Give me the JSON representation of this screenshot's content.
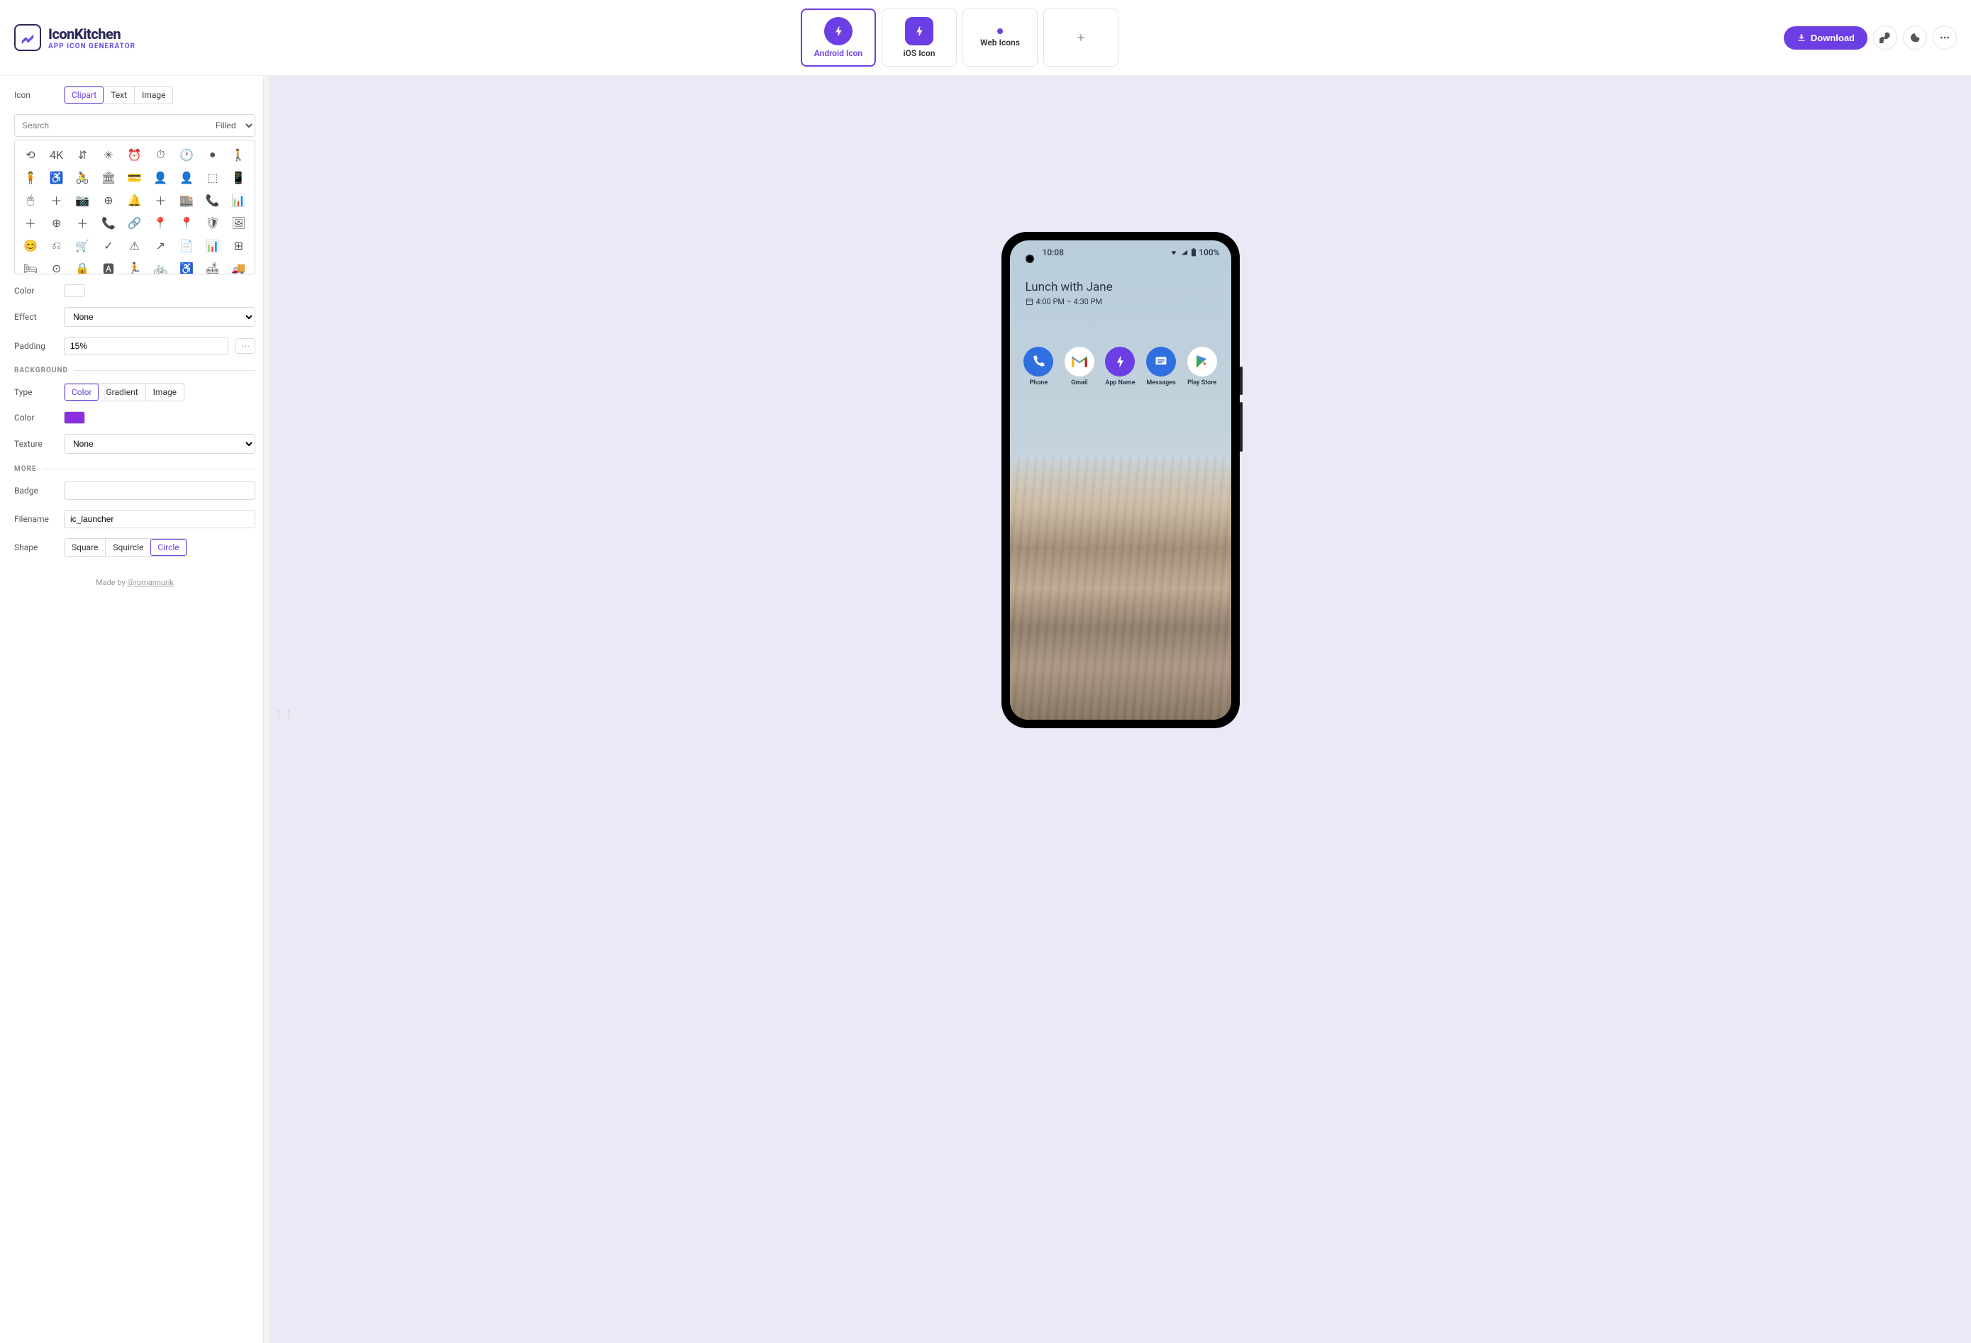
{
  "header": {
    "logo_title": "IconKitchen",
    "logo_sub": "APP ICON GENERATOR",
    "tabs": [
      {
        "label": "Android Icon",
        "active": true
      },
      {
        "label": "iOS Icon",
        "active": false
      },
      {
        "label": "Web Icons",
        "active": false
      }
    ],
    "download_label": "Download"
  },
  "sidebar": {
    "icon_label": "Icon",
    "icon_tabs": [
      "Clipart",
      "Text",
      "Image"
    ],
    "icon_tab_active": "Clipart",
    "search_placeholder": "Search",
    "style_select": "Filled",
    "color_label": "Color",
    "color_value": "#ffffff",
    "effect_label": "Effect",
    "effect_value": "None",
    "padding_label": "Padding",
    "padding_value": "15%",
    "bg_header": "BACKGROUND",
    "type_label": "Type",
    "type_tabs": [
      "Color",
      "Gradient",
      "Image"
    ],
    "type_active": "Color",
    "bg_color_label": "Color",
    "bg_color_value": "#7e22ce",
    "texture_label": "Texture",
    "texture_value": "None",
    "more_header": "MORE",
    "badge_label": "Badge",
    "badge_value": "",
    "filename_label": "Filename",
    "filename_value": "ic_launcher",
    "shape_label": "Shape",
    "shape_tabs": [
      "Square",
      "Squircle",
      "Circle"
    ],
    "shape_active": "Circle",
    "footer_prefix": "Made by ",
    "footer_link": "@romannurik"
  },
  "preview": {
    "status_time": "10:08",
    "status_battery": "100%",
    "widget_title": "Lunch with Jane",
    "widget_time": "4:00 PM – 4:30 PM",
    "apps": [
      {
        "label": "Phone",
        "bg": "#2f6fe0",
        "glyph": "phone"
      },
      {
        "label": "Gmail",
        "bg": "#ffffff",
        "glyph": "gmail"
      },
      {
        "label": "App Name",
        "bg": "#6b3fe4",
        "glyph": "bolt"
      },
      {
        "label": "Messages",
        "bg": "#2f6fe0",
        "glyph": "msg"
      },
      {
        "label": "Play Store",
        "bg": "#ffffff",
        "glyph": "play"
      }
    ]
  },
  "clipart_glyphs": [
    "⟲",
    "4K",
    "⇵",
    "✳",
    "⏰",
    "⏱",
    "🕐",
    "●",
    "🚶",
    "🧍",
    "♿",
    "🚴",
    "🏛",
    "💳",
    "👤",
    "👤",
    "⬚",
    "📱",
    "🖱",
    "＋",
    "📷",
    "⊕",
    "🔔",
    "＋",
    "🏬",
    "📞",
    "📊",
    "＋",
    "⊕",
    "＋",
    "📞",
    "🔗",
    "📍",
    "📍",
    "🛡",
    "🖼",
    "😊",
    "⎌",
    "🛒",
    "✓",
    "⚠",
    "↗",
    "📄",
    "📊",
    "⊞",
    "🛏",
    "⊙",
    "🔒",
    "🅰",
    "🏃",
    "🚲",
    "♿",
    "🛋",
    "🚚",
    "🛏",
    "🎵",
    "🎵",
    "🎵",
    "🏛",
    "↗",
    "🏃",
    "↗",
    "🔒"
  ]
}
